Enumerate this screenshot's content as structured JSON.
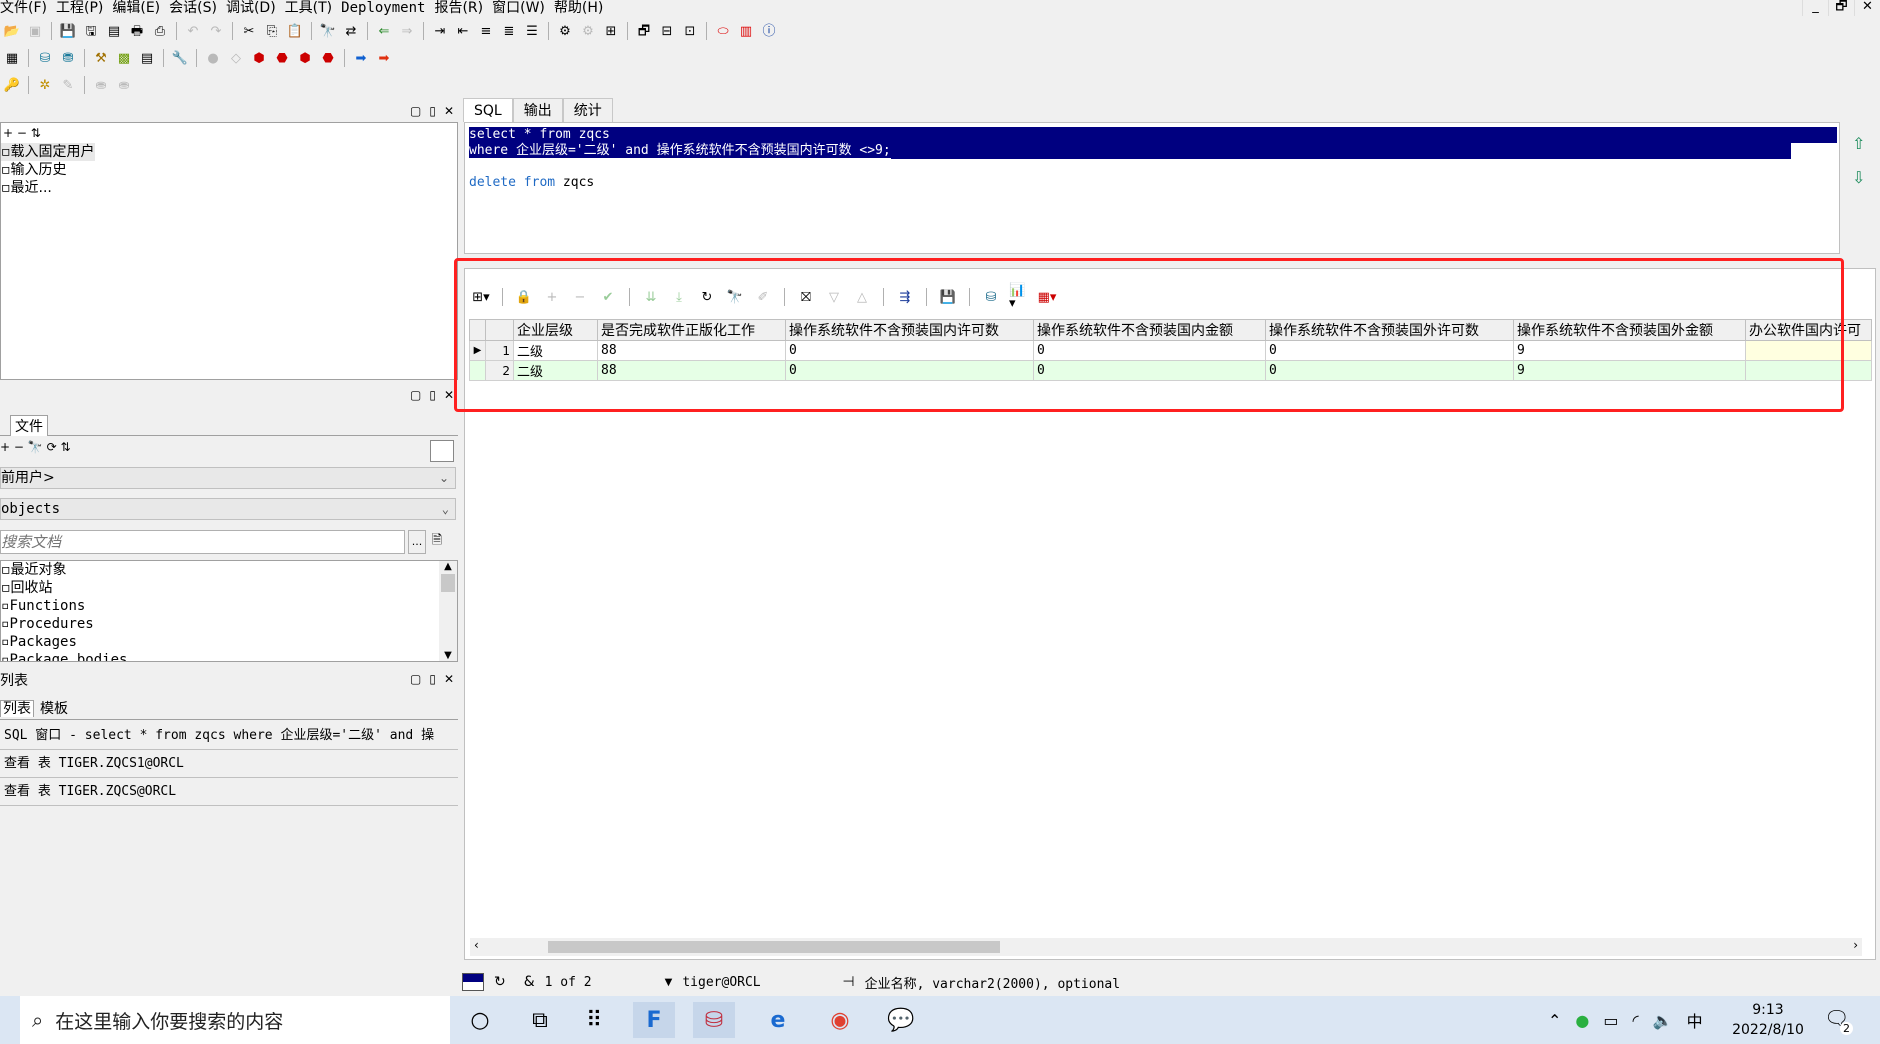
{
  "menu": [
    "文件(F)",
    "工程(P)",
    "编辑(E)",
    "会话(S)",
    "调试(D)",
    "工具(T)",
    "Deployment",
    "报告(R)",
    "窗口(W)",
    "帮助(H)"
  ],
  "window_controls": [
    "_",
    "🗗",
    "✕"
  ],
  "top_panel": {
    "items": [
      "载入固定用户",
      "输入历史",
      "最近..."
    ]
  },
  "object_panel": {
    "tabs": [
      "文件"
    ],
    "user_combo": "前用户>",
    "type_combo": "objects",
    "search_placeholder": "搜索文档",
    "items": [
      "最近对象",
      "回收站",
      "Functions",
      "Procedures",
      "Packages",
      "Package bodies"
    ]
  },
  "window_list": {
    "title": "列表",
    "tabs": [
      "列表",
      "模板"
    ],
    "items": [
      "SQL 窗口 - select * from zqcs where 企业层级='二级' and 操",
      "查看 表 TIGER.ZQCS1@ORCL",
      "查看 表 TIGER.ZQCS@ORCL"
    ]
  },
  "sql_tabs": [
    "SQL",
    "输出",
    "统计"
  ],
  "editor": {
    "line1": "select * from zqcs",
    "line2": "where 企业层级='二级' and 操作系统软件不含预装国内许可数 <>9;",
    "line4_kw1": "delete",
    "line4_kw2": "from",
    "line4_rest": " zqcs"
  },
  "grid": {
    "columns": [
      "企业层级",
      "是否完成软件正版化工作",
      "操作系统软件不含预装国内许可数",
      "操作系统软件不含预装国内金额",
      "操作系统软件不含预装国外许可数",
      "操作系统软件不含预装国外金额",
      "办公软件国内许可"
    ],
    "rows": [
      [
        "1",
        "二级",
        "88",
        "0",
        "0",
        "0",
        "9"
      ],
      [
        "2",
        "二级",
        "88",
        "0",
        "0",
        "0",
        "9"
      ]
    ]
  },
  "status": {
    "pager": "1 of 2",
    "connection": "tiger@ORCL",
    "field_info": "企业名称, varchar2(2000), optional"
  },
  "taskbar": {
    "search_placeholder": "在这里输入你要搜索的内容",
    "ime": "中",
    "time": "9:13",
    "date": "2022/8/10",
    "notif_count": "2"
  }
}
